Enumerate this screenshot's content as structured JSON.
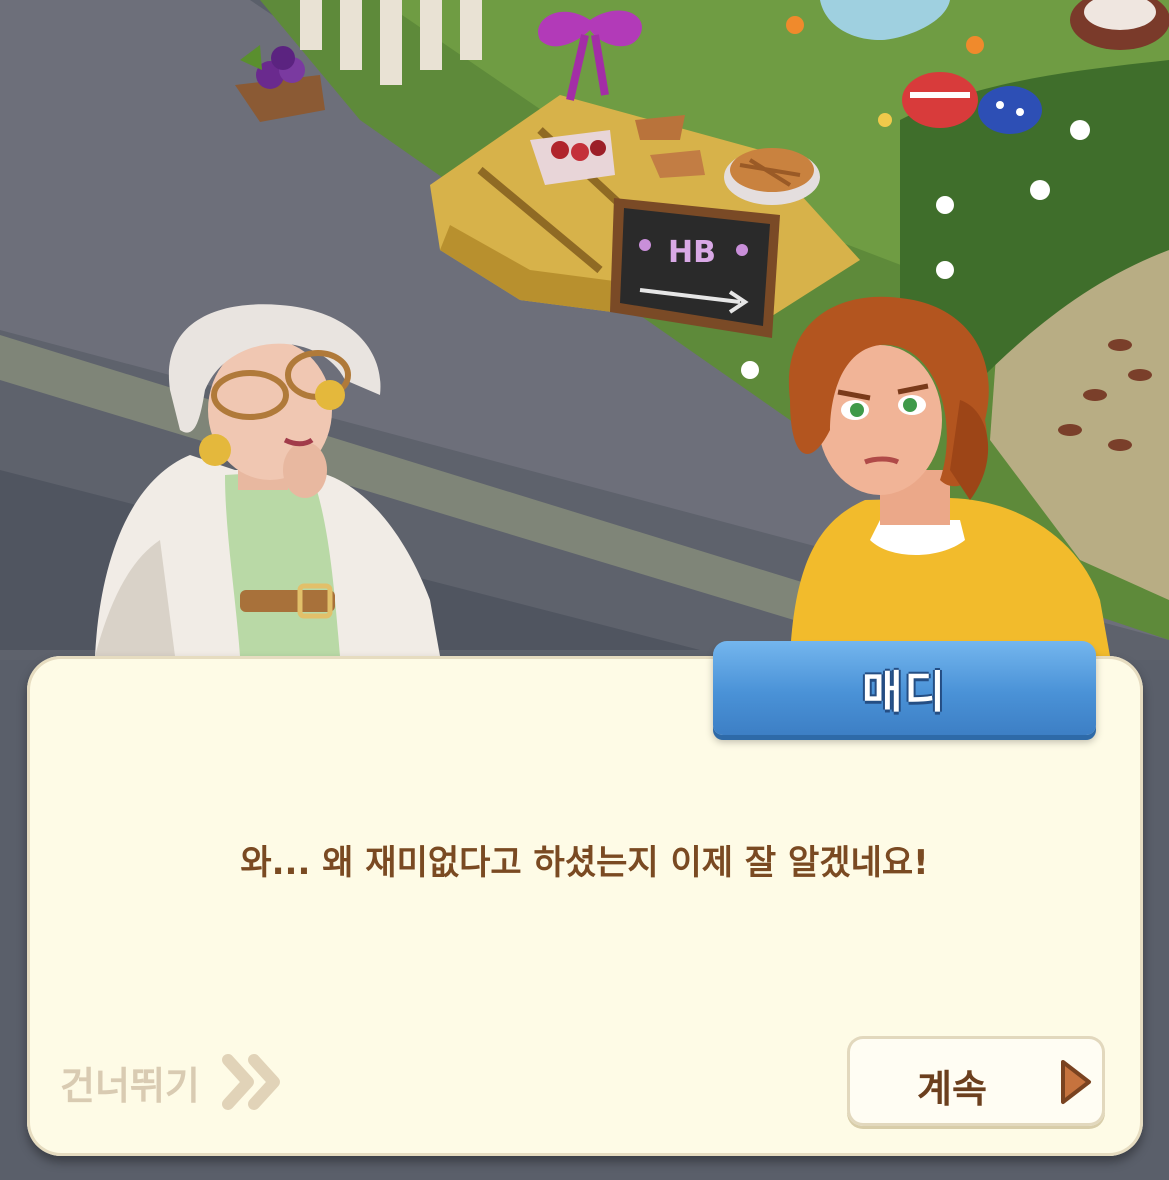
{
  "speaker": {
    "name": "매디"
  },
  "dialogue": {
    "text": "와... 왜 재미없다고 하셨는지 이제 잘 알겠네요!"
  },
  "controls": {
    "skip_label": "건너뛰기",
    "continue_label": "계속"
  },
  "scene": {
    "chalkboard_text": "HB"
  },
  "colors": {
    "dialog_bg": "#fefbe6",
    "name_tag": "#4a92d7",
    "dialog_text": "#7a4a22",
    "continue_arrow": "#c6733e"
  }
}
